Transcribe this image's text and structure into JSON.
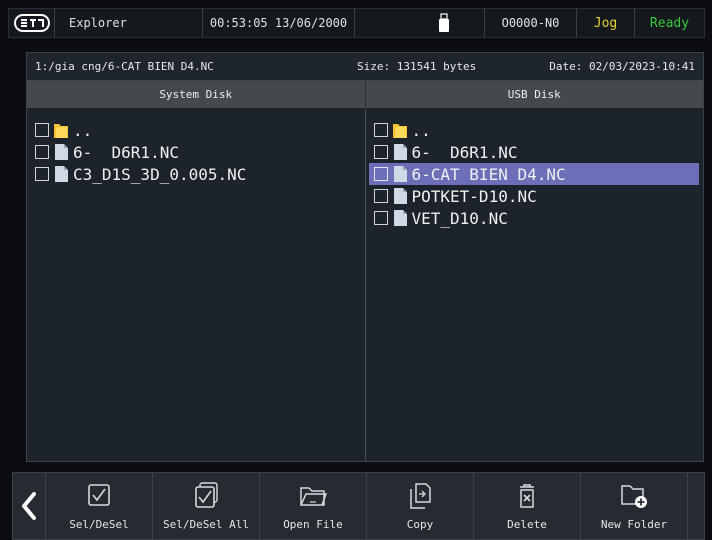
{
  "status_bar": {
    "logo_text": "STD",
    "app_title": "Explorer",
    "datetime": "00:53:05 13/06/2000",
    "program": "O0000-N0",
    "mode": "Jog",
    "state": "Ready",
    "colors": {
      "mode": "#e3d230",
      "state": "#36c93c"
    }
  },
  "file_info": {
    "path": "1:/gia cng/6-CAT BIEN D4.NC",
    "size": "Size: 131541 bytes",
    "date": "Date: 02/03/2023-10:41"
  },
  "system_disk": {
    "header": "System Disk",
    "items": [
      {
        "name": "..",
        "icon": "folder-icon"
      },
      {
        "name": "6-  D6R1.NC",
        "icon": "file-icon"
      },
      {
        "name": "C3_D1S_3D_0.005.NC",
        "icon": "file-icon"
      }
    ]
  },
  "usb_disk": {
    "header": "USB Disk",
    "items": [
      {
        "name": "..",
        "icon": "folder-icon"
      },
      {
        "name": "6-  D6R1.NC",
        "icon": "file-icon"
      },
      {
        "name": "6-CAT BIEN D4.NC",
        "icon": "file-icon",
        "selected": true
      },
      {
        "name": "POTKET-D10.NC",
        "icon": "file-icon"
      },
      {
        "name": "VET_D10.NC",
        "icon": "file-icon"
      }
    ]
  },
  "toolbar": {
    "back_icon": "chevron-left-icon",
    "buttons": [
      {
        "label": "Sel/DeSel",
        "icon": "checkbox-icon"
      },
      {
        "label": "Sel/DeSel All",
        "icon": "checkbox-stack-icon"
      },
      {
        "label": "Open File",
        "icon": "open-folder-icon"
      },
      {
        "label": "Copy",
        "icon": "copy-icon"
      },
      {
        "label": "Delete",
        "icon": "trash-icon"
      },
      {
        "label": "New Folder",
        "icon": "new-folder-icon"
      }
    ]
  },
  "colors": {
    "selection": "#6c6fb8",
    "folder": "#f2c230",
    "file": "#cfd9e6"
  }
}
